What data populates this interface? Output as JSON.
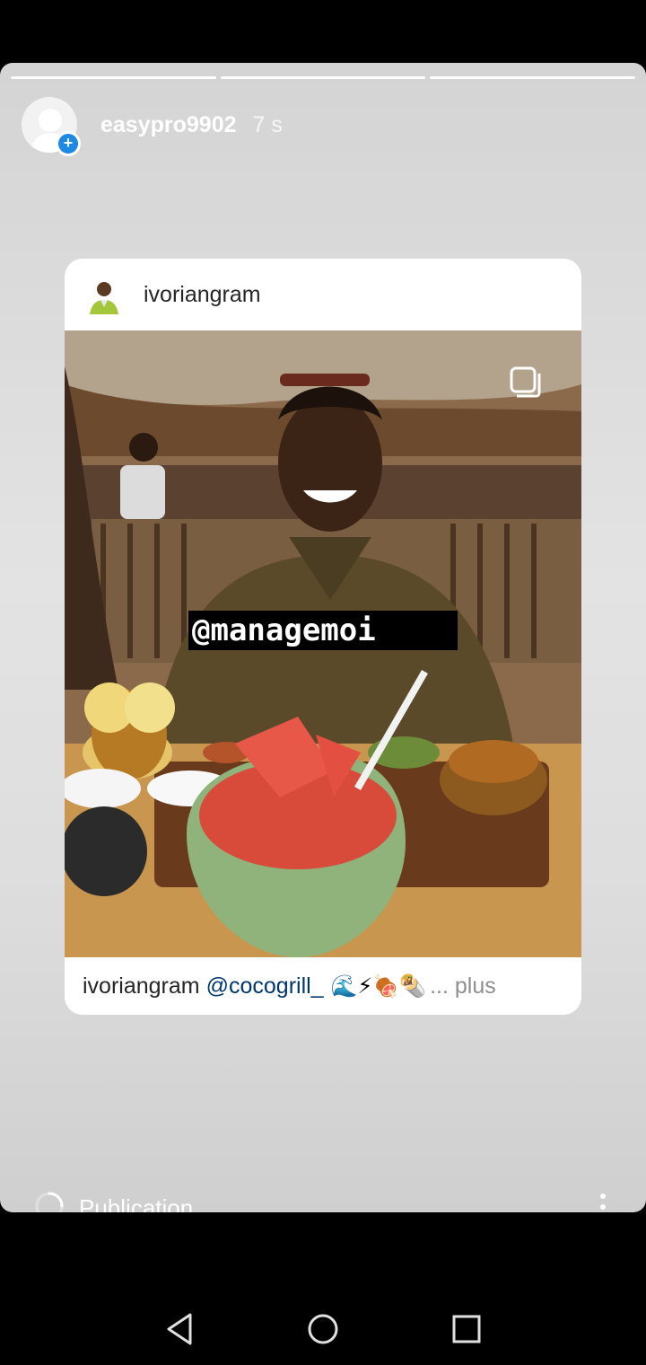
{
  "story": {
    "username": "easypro9902",
    "time": "7 s",
    "segments": 3
  },
  "post": {
    "author": "ivoriangram",
    "mention_sticker": "@managemoi",
    "caption": {
      "user": "ivoriangram",
      "tag": "@cocogrill_",
      "emoji": "🌊⚡🍖🌯",
      "more": "... plus"
    }
  },
  "status": {
    "publishing": "Publication..."
  },
  "icons": {
    "avatar": "default-avatar-icon",
    "add": "plus-badge-icon",
    "multi": "multiple-photos-icon",
    "spinner": "loading-spinner-icon",
    "more": "more-vertical-icon",
    "back": "nav-back-icon",
    "home": "nav-home-icon",
    "recent": "nav-recents-icon"
  },
  "colors": {
    "accent": "#1e88e5",
    "link": "#00376b"
  }
}
